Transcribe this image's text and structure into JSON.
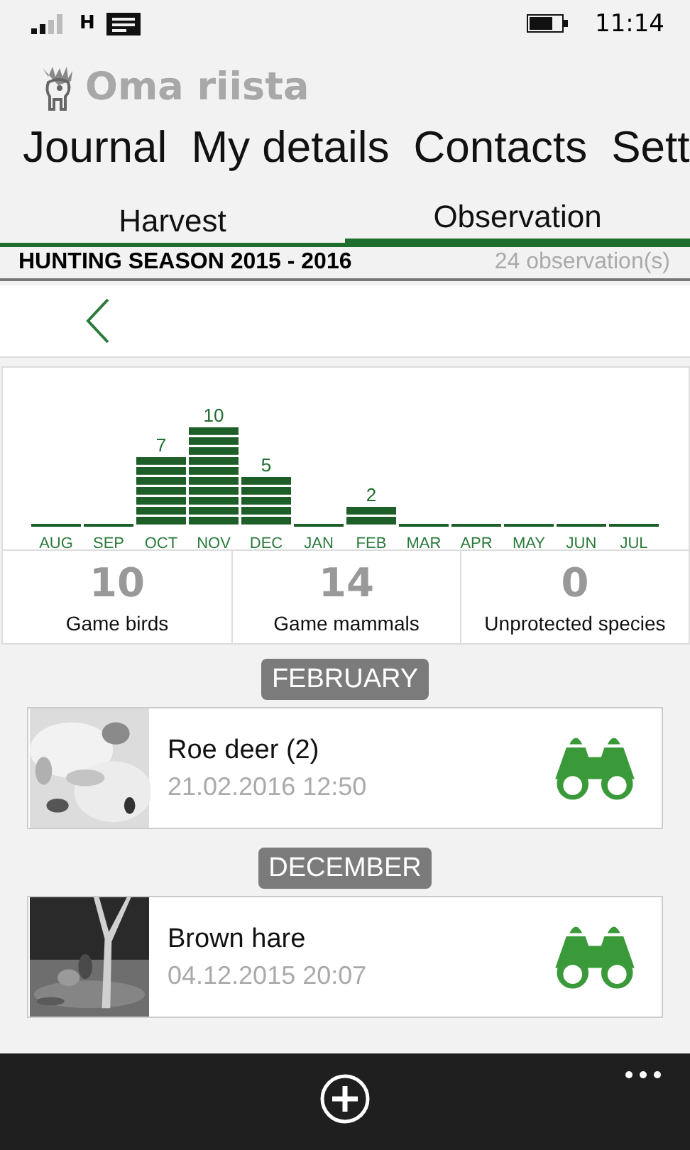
{
  "status_bar": {
    "network": "H",
    "time": "11:14"
  },
  "app": {
    "title": "Oma riista"
  },
  "pivot": [
    "Journal",
    "My details",
    "Contacts",
    "Sett"
  ],
  "tabs": [
    {
      "label": "Harvest",
      "selected": false
    },
    {
      "label": "Observation",
      "selected": true
    }
  ],
  "season": {
    "title": "HUNTING SEASON 2015 - 2016",
    "count": "24 observation(s)"
  },
  "chart_data": {
    "type": "bar",
    "categories": [
      "AUG",
      "SEP",
      "OCT",
      "NOV",
      "DEC",
      "JAN",
      "FEB",
      "MAR",
      "APR",
      "MAY",
      "JUN",
      "JUL"
    ],
    "values": [
      0,
      0,
      7,
      10,
      5,
      0,
      2,
      0,
      0,
      0,
      0,
      0
    ],
    "value_labels": [
      null,
      null,
      "7",
      "10",
      "5",
      null,
      "2",
      null,
      null,
      null,
      null,
      null
    ]
  },
  "totals": [
    {
      "value": "10",
      "label": "Game birds"
    },
    {
      "value": "14",
      "label": "Game mammals"
    },
    {
      "value": "0",
      "label": "Unprotected species"
    }
  ],
  "sections": [
    {
      "month": "FEBRUARY",
      "entries": [
        {
          "title": "Roe deer (2)",
          "datetime": "21.02.2016 12:50",
          "kind": "observation"
        }
      ]
    },
    {
      "month": "DECEMBER",
      "entries": [
        {
          "title": "Brown hare",
          "datetime": "04.12.2015 20:07",
          "kind": "observation"
        }
      ]
    }
  ]
}
